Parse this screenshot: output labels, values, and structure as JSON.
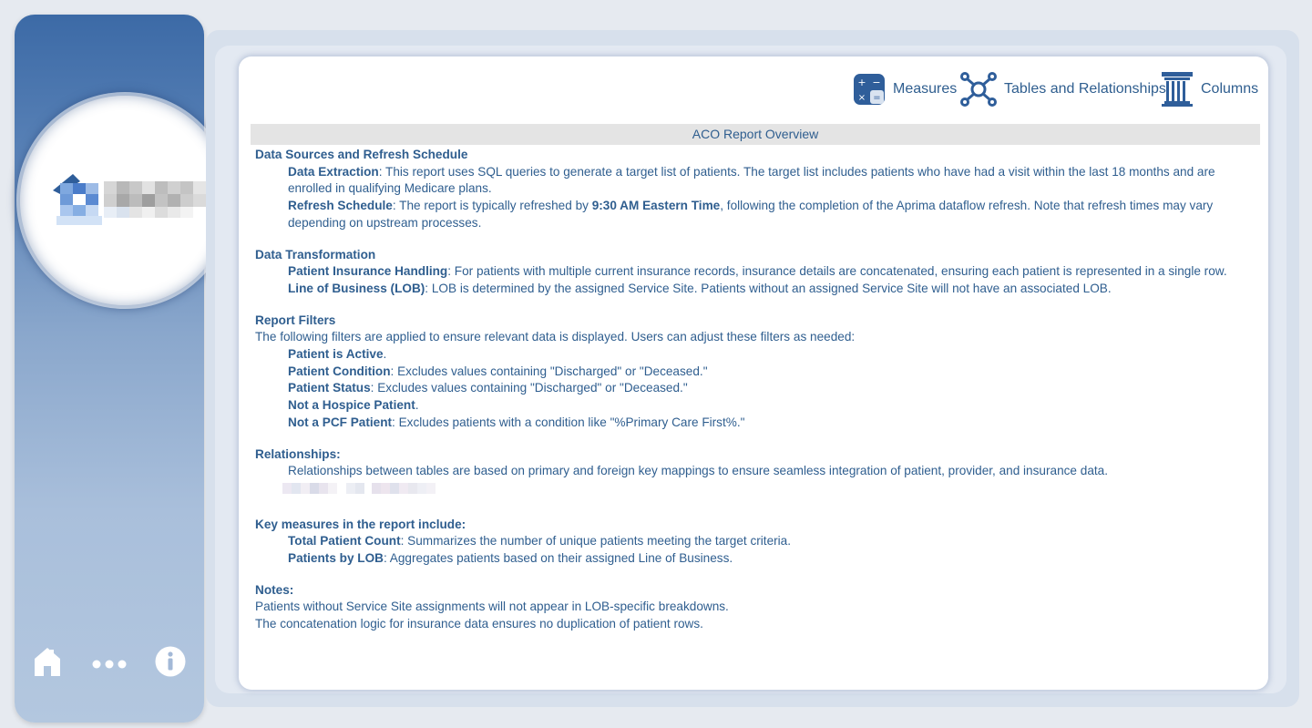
{
  "sidebar": {
    "icons": [
      "home-icon",
      "more-dots-icon",
      "info-icon"
    ]
  },
  "toolbar": {
    "measures_label": "Measures",
    "tables_label": "Tables and Relationships",
    "columns_label": "Columns"
  },
  "report": {
    "title": "ACO Report Overview",
    "sections": {
      "data_sources": {
        "heading": "Data Sources and Refresh Schedule",
        "extraction_label": "Data Extraction",
        "extraction_text": ": This report uses SQL queries to generate a target list of patients. The target list includes patients who have had a visit within the last 18 months and are enrolled in qualifying Medicare plans.",
        "refresh_label": "Refresh Schedule",
        "refresh_text_1": ": The report is typically refreshed by ",
        "refresh_time": "9:30 AM Eastern Time",
        "refresh_text_2": ", following the completion of the Aprima dataflow refresh. Note that refresh times may vary depending on upstream processes."
      },
      "transformation": {
        "heading": "Data Transformation",
        "insurance_label": "Patient Insurance Handling",
        "insurance_text": ": For patients with multiple current insurance records, insurance details are concatenated, ensuring each patient is represented in a single row.",
        "lob_label": "Line of Business (LOB)",
        "lob_text": ": LOB is determined by the assigned Service Site. Patients without an assigned Service Site will not have an associated LOB."
      },
      "filters": {
        "heading": "Report Filters",
        "intro": "The following filters are applied to ensure relevant data is displayed. Users can adjust these filters as needed:",
        "items": [
          {
            "label": "Patient is Active",
            "text": "."
          },
          {
            "label": "Patient Condition",
            "text": ": Excludes values containing \"Discharged\" or \"Deceased.\""
          },
          {
            "label": "Patient Status",
            "text": ": Excludes values containing \"Discharged\" or \"Deceased.\""
          },
          {
            "label": "Not a Hospice Patient",
            "text": "."
          },
          {
            "label": "Not a PCF Patient",
            "text": ": Excludes patients with a condition like \"%Primary Care First%.\""
          }
        ]
      },
      "relationships": {
        "heading": "Relationships:",
        "text": "Relationships between tables are based on primary and foreign key mappings to ensure seamless integration of patient, provider, and insurance data."
      },
      "measures": {
        "heading": "Key measures in the report include:",
        "items": [
          {
            "label": "Total Patient Count",
            "text": ": Summarizes the number of unique patients meeting the target criteria."
          },
          {
            "label": "Patients by LOB",
            "text": ": Aggregates patients based on their assigned Line of Business."
          }
        ]
      },
      "notes": {
        "heading": "Notes:",
        "lines": [
          "Patients without Service Site assignments will not appear in LOB-specific breakdowns.",
          "The concatenation logic for insurance data ensures no duplication of patient rows."
        ]
      }
    }
  },
  "colors": {
    "text": "#2f5e8f",
    "sidebar_top": "#3c6aa6",
    "sidebar_bottom": "#b3c7df",
    "header_bar": "#e4e4e4"
  }
}
